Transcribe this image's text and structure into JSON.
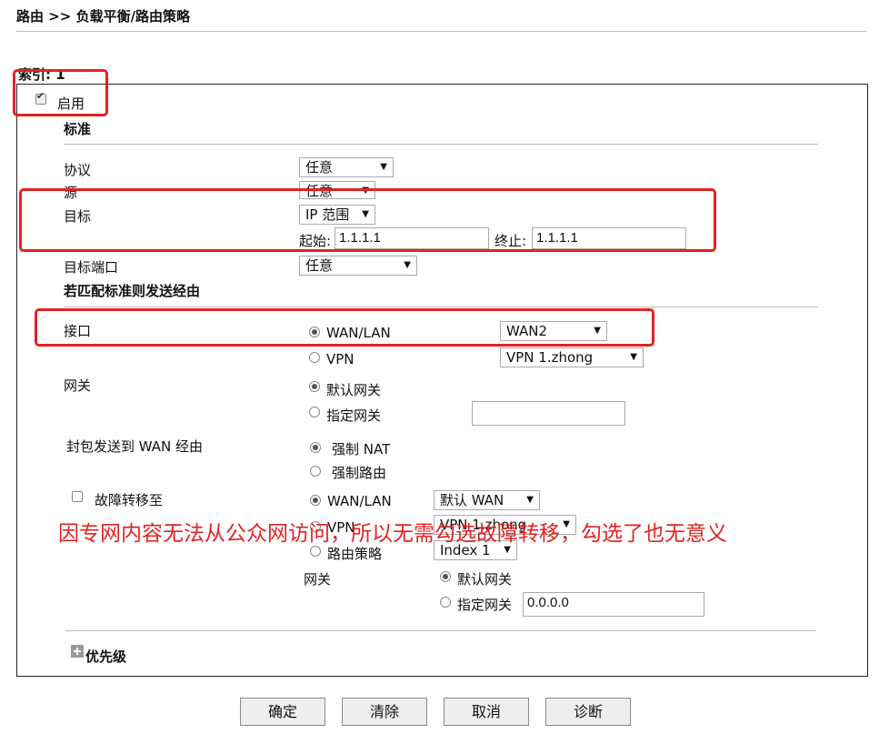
{
  "breadcrumb": "路由 >> 负载平衡/路由策略",
  "index_label": "索引: 1",
  "enable_label": "启用",
  "criteria": {
    "heading": "标准",
    "protocol_label": "协议",
    "protocol_value": "任意",
    "source_label": "源",
    "source_value": "任意",
    "dest_label": "目标",
    "dest_value": "IP 范围",
    "start_label": "起始:",
    "start_value": "1.1.1.1",
    "end_label": "终止:",
    "end_value": "1.1.1.1",
    "dest_port_label": "目标端口",
    "dest_port_value": "任意"
  },
  "route": {
    "heading": "若匹配标准则发送经由",
    "interface_label": "接口",
    "wanlan_label": "WAN/LAN",
    "wanlan_value": "WAN2",
    "vpn_label": "VPN",
    "vpn_value": "VPN 1.zhong",
    "gateway_label": "网关",
    "default_gw_label": "默认网关",
    "specific_gw_label": "指定网关",
    "specific_gw_value": "",
    "packet_label": "封包发送到 WAN 经由",
    "force_nat_label": "强制 NAT",
    "force_route_label": "强制路由"
  },
  "failover": {
    "label": "故障转移至",
    "wanlan_label": "WAN/LAN",
    "wanlan_value": "默认 WAN",
    "vpn_label": "VPN",
    "vpn_value": "VPN 1.zhong",
    "policy_label": "路由策略",
    "policy_value": "Index 1",
    "gateway_label": "网关",
    "default_gw_label": "默认网关",
    "specific_gw_label": "指定网关",
    "specific_gw_value": "0.0.0.0"
  },
  "priority_label": "优先级",
  "annotation": "因专网内容无法从公众网访问，所以无需勾选故障转移，勾选了也无意义",
  "buttons": {
    "ok": "确定",
    "clear": "清除",
    "cancel": "取消",
    "diagnose": "诊断"
  },
  "colors": {
    "annotation_red": "#e32222"
  }
}
